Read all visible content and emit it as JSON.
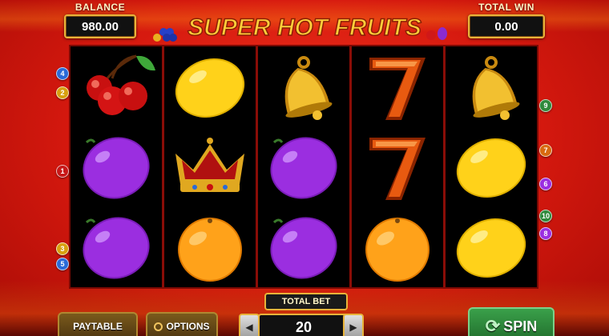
{
  "header": {
    "balance_label": "BALANCE",
    "balance_value": "980.00",
    "total_win_label": "TOTAL WIN",
    "total_win_value": "0.00",
    "logo_text": "SUPER HOT FRUITS"
  },
  "reels": [
    [
      "cherries",
      "plum",
      "plum"
    ],
    [
      "lemon",
      "crown",
      "orange"
    ],
    [
      "bell",
      "plum",
      "plum"
    ],
    [
      "seven",
      "seven",
      "orange"
    ],
    [
      "bell",
      "lemon",
      "lemon"
    ]
  ],
  "paylines": {
    "left": [
      "4",
      "2",
      "1",
      "3",
      "5"
    ],
    "right": [
      "9",
      "7",
      "6",
      "10",
      "8"
    ]
  },
  "controls": {
    "paytable_label": "PAYTABLE",
    "options_label": "OPTIONS",
    "total_bet_label": "TOTAL BET",
    "total_bet_value": "20",
    "spin_label": "SPIN"
  },
  "colors": {
    "background": "#d4180e",
    "frame_gold": "#e8b43a",
    "spin_green": "#2f8a3c"
  }
}
